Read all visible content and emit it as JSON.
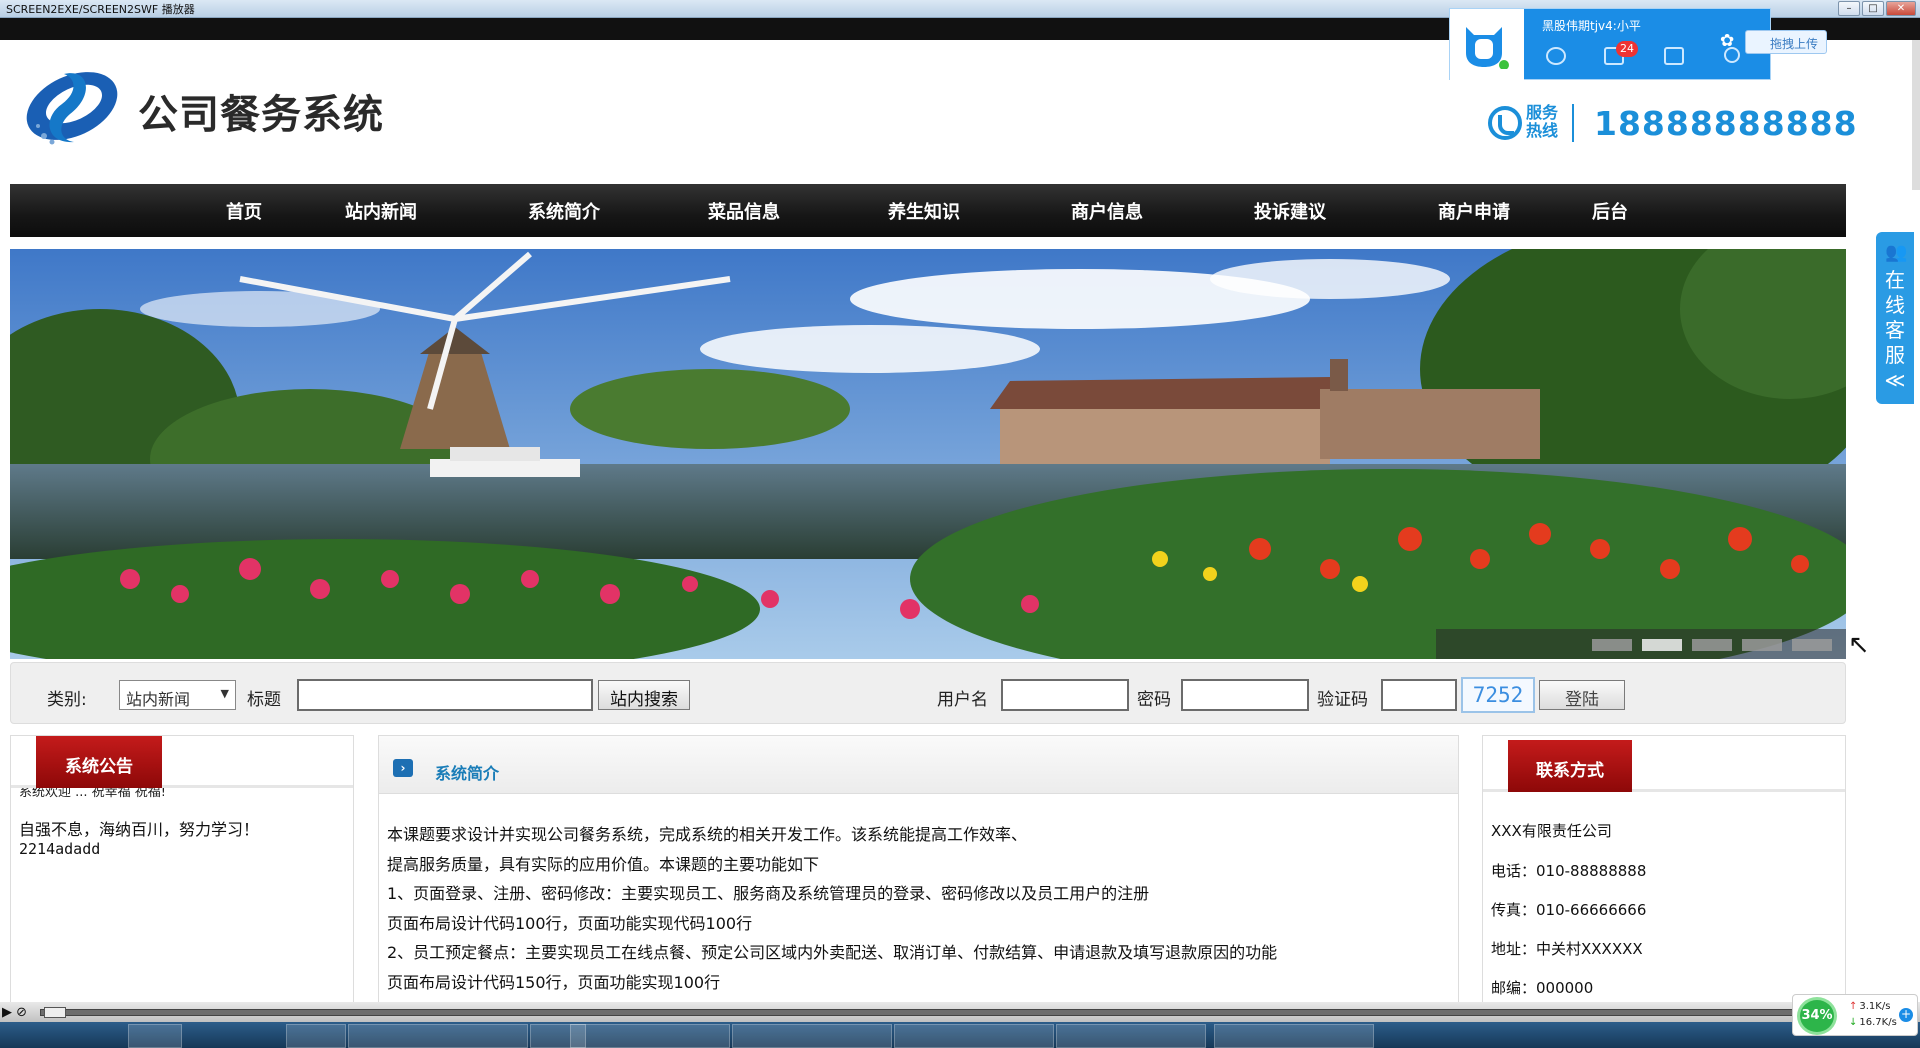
{
  "window": {
    "title": "SCREEN2EXE/SCREEN2SWF 播放器",
    "buttons": [
      "–",
      "□",
      "✕"
    ]
  },
  "site": {
    "logo_text": "公司餐务系统",
    "hotline_label": "服务热线",
    "hotline_number": "18888888888"
  },
  "nav": [
    "首页",
    "站内新闻",
    "系统简介",
    "菜品信息",
    "养生知识",
    "商户信息",
    "投诉建议",
    "商户申请",
    "后台"
  ],
  "banner": {
    "slides": 5,
    "active_slide": 2
  },
  "search": {
    "category_label": "类别:",
    "category_value": "站内新闻",
    "title_label": "标题",
    "title_value": "",
    "search_button": "站内搜索"
  },
  "login": {
    "username_label": "用户名",
    "password_label": "密码",
    "captcha_label": "验证码",
    "captcha_code": "7252",
    "login_button": "登陆"
  },
  "announcement": {
    "tab": "系统公告",
    "cut_line": "系统欢迎 ... 祝幸福 祝福!",
    "line1": "自强不息，海纳百川，努力学习！",
    "line2": "2214adadd"
  },
  "intro": {
    "title": "系统简介",
    "lines": [
      "本课题要求设计并实现公司餐务系统，完成系统的相关开发工作。该系统能提高工作效率、",
      "提高服务质量，具有实际的应用价值。本课题的主要功能如下",
      "1、页面登录、注册、密码修改：主要实现员工、服务商及系统管理员的登录、密码修改以及员工用户的注册",
      "页面布局设计代码100行，页面功能实现代码100行",
      "2、员工预定餐点：主要实现员工在线点餐、预定公司区域内外卖配送、取消订单、付款结算、申请退款及填写退款原因的功能",
      "页面布局设计代码150行，页面功能实现100行"
    ]
  },
  "contact": {
    "tab": "联系方式",
    "company": "XXX有限责任公司",
    "phone": "电话：010-88888888",
    "fax": "传真：010-66666666",
    "address": "地址：中关村XXXXXX",
    "postcode": "邮编：000000"
  },
  "qq_popup": {
    "name": "黑股伟期tjv4:小平",
    "mail_badge": "24",
    "upload_button": "拖拽上传"
  },
  "online_service": {
    "label": "在线客服",
    "collapse": "≪"
  },
  "net_meter": {
    "percent": "34%",
    "up": "3.1K/s",
    "down": "16.7K/s"
  },
  "colors": {
    "accent_blue": "#1b8fd9",
    "nav_bg": "#161616",
    "tab_red": "#a50f0f",
    "intro_title": "#1a7db8"
  }
}
